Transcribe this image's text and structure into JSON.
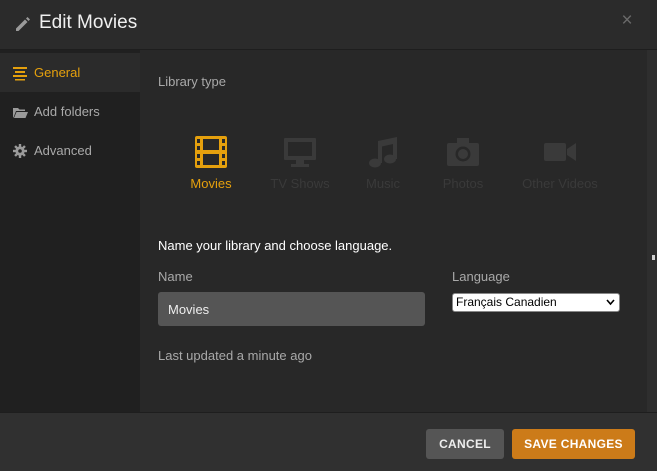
{
  "header": {
    "title": "Edit Movies",
    "close_glyph": "×"
  },
  "sidebar": {
    "items": [
      {
        "label": "General",
        "icon": "list-lines-icon",
        "active": true
      },
      {
        "label": "Add folders",
        "icon": "folder-icon",
        "active": false
      },
      {
        "label": "Advanced",
        "icon": "gear-icon",
        "active": false
      }
    ]
  },
  "main": {
    "library_type_label": "Library type",
    "types": [
      {
        "label": "Movies",
        "icon": "film-icon",
        "selected": true
      },
      {
        "label": "TV Shows",
        "icon": "tv-icon",
        "selected": false
      },
      {
        "label": "Music",
        "icon": "music-note-icon",
        "selected": false
      },
      {
        "label": "Photos",
        "icon": "camera-icon",
        "selected": false
      },
      {
        "label": "Other Videos",
        "icon": "video-camera-icon",
        "selected": false
      }
    ],
    "instruction": "Name your library and choose language.",
    "name_label": "Name",
    "name_value": "Movies",
    "language_label": "Language",
    "language_value": "Français Canadien",
    "last_updated": "Last updated a minute ago"
  },
  "footer": {
    "cancel_label": "CANCEL",
    "save_label": "SAVE CHANGES"
  },
  "colors": {
    "accent": "#e5a00d",
    "save_button": "#cc7b19",
    "sidebar_bg": "#202020",
    "content_bg": "#282828"
  }
}
